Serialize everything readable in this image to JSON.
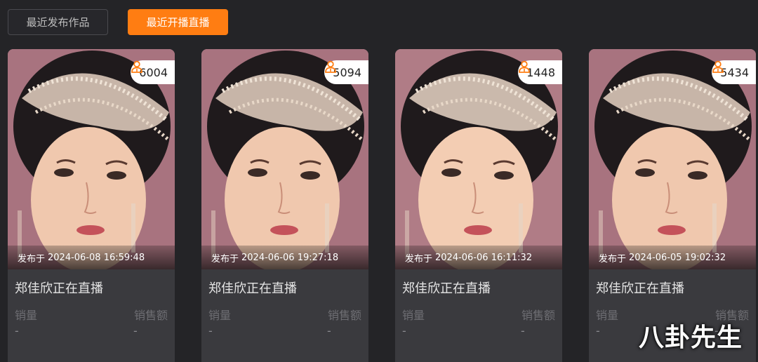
{
  "tabs": {
    "recent_works": "最近发布作品",
    "recent_live": "最近开播直播"
  },
  "accent_color": "#ff7d12",
  "cards": [
    {
      "viewers": "6004",
      "published_label": "发布于",
      "published_at": "2024-06-08 16:59:48",
      "title": "郑佳欣正在直播",
      "sales_label": "销量",
      "revenue_label": "销售额",
      "sales_value": "-",
      "revenue_value": "-"
    },
    {
      "viewers": "5094",
      "published_label": "发布于",
      "published_at": "2024-06-06 19:27:18",
      "title": "郑佳欣正在直播",
      "sales_label": "销量",
      "revenue_label": "销售额",
      "sales_value": "-",
      "revenue_value": "-"
    },
    {
      "viewers": "1448",
      "published_label": "发布于",
      "published_at": "2024-06-06 16:11:32",
      "title": "郑佳欣正在直播",
      "sales_label": "销量",
      "revenue_label": "销售额",
      "sales_value": "-",
      "revenue_value": "-"
    },
    {
      "viewers": "5434",
      "published_label": "发布于",
      "published_at": "2024-06-05 19:02:32",
      "title": "郑佳欣正在直播",
      "sales_label": "销量",
      "revenue_label": "销售额",
      "sales_value": "-",
      "revenue_value": "-"
    }
  ],
  "watermark": "八卦先生"
}
